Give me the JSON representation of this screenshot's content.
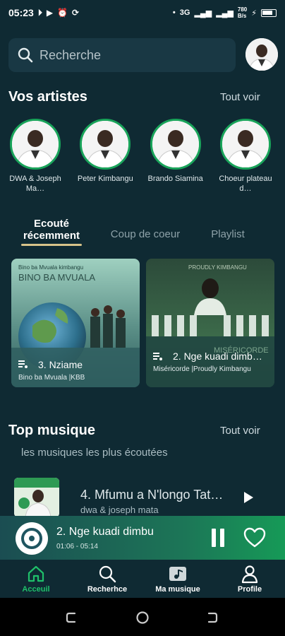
{
  "status_bar": {
    "time": "05:23",
    "network": "3G",
    "speed_value": "780",
    "speed_unit": "B/s"
  },
  "search": {
    "placeholder": "Recherche"
  },
  "artists_section": {
    "title": "Vos artistes",
    "see_all": "Tout voir",
    "artists": [
      {
        "name": "DWA & Joseph Ma…"
      },
      {
        "name": "Peter Kimbangu"
      },
      {
        "name": "Brando Siamina"
      },
      {
        "name": "Choeur plateau d…"
      }
    ]
  },
  "tabs": [
    {
      "label": "Ecouté récemment",
      "active": true
    },
    {
      "label": "Coup de coeur",
      "active": false
    },
    {
      "label": "Playlist",
      "active": false
    }
  ],
  "recent": [
    {
      "title": "3. Nziame",
      "subtitle": "Bino ba Mvuala |KBB",
      "art_text": "BINO BA MVUALA",
      "art_subtext": "Bino ba Mvuala kimbangu"
    },
    {
      "title": "2. Nge kuadi dimb…",
      "subtitle": "Miséricorde |Proudly Kimbangu",
      "art_text": "MISÉRICORDE",
      "art_subtext": "PROUDLY KIMBANGU"
    }
  ],
  "top_section": {
    "title": "Top musique",
    "see_all": "Tout voir",
    "subtitle": "les musiques les plus écoutées",
    "tracks": [
      {
        "title": "4. Mfumu a N'longo Tat…",
        "artist": "dwa & joseph mata"
      }
    ]
  },
  "player": {
    "title": "2. Nge kuadi dimbu",
    "time": "01:06 - 05:14"
  },
  "bottom_nav": [
    {
      "label": "Acceuil",
      "icon": "home-icon",
      "active": true
    },
    {
      "label": "Recherhce",
      "icon": "search-icon",
      "active": false
    },
    {
      "label": "Ma musique",
      "icon": "music-library-icon",
      "active": false
    },
    {
      "label": "Profile",
      "icon": "profile-icon",
      "active": false
    }
  ],
  "colors": {
    "background": "#0f2a33",
    "accent_green": "#19a45a",
    "tab_underline": "#d8c48a"
  }
}
